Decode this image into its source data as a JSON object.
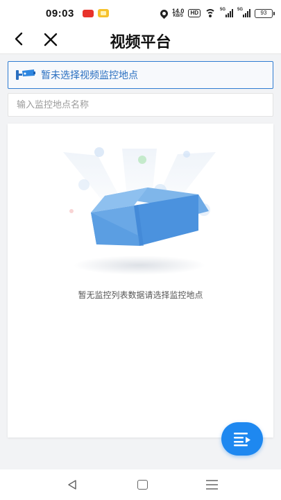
{
  "status_bar": {
    "time": "09:03",
    "speed_value": "14.0",
    "speed_unit": "KB/S",
    "hd_label": "HD",
    "network_1": "5G",
    "network_2": "5G",
    "battery": "93"
  },
  "nav": {
    "title": "视频平台"
  },
  "location": {
    "label": "暂未选择视频监控地点"
  },
  "search": {
    "placeholder": "输入监控地点名称"
  },
  "list": {
    "empty_text": "暂无监控列表数据请选择监控地点"
  },
  "colors": {
    "accent": "#1e88f0",
    "location_border": "#2e7bd1",
    "location_text": "#2a6fc0"
  }
}
